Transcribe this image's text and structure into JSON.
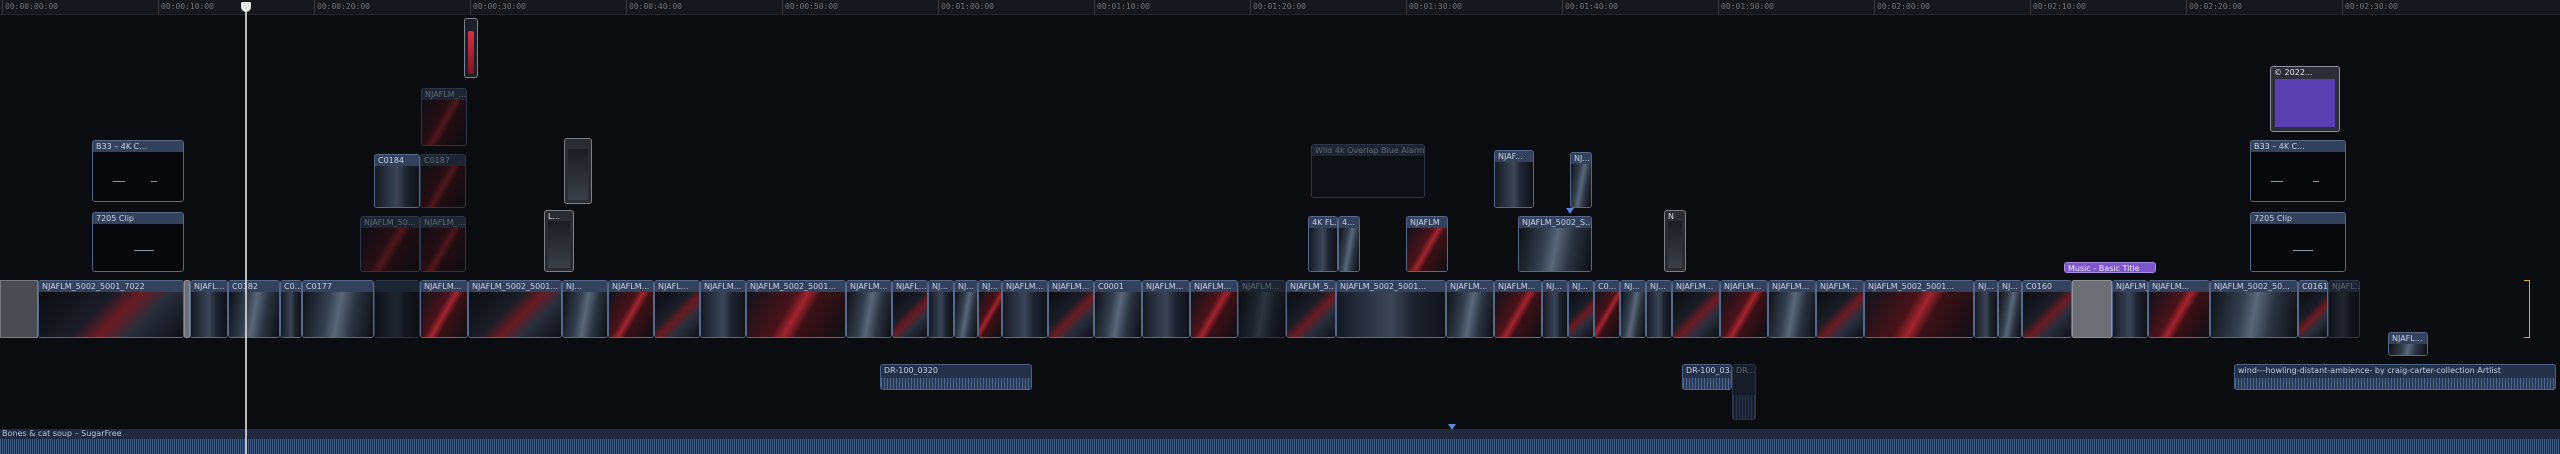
{
  "window_title": "",
  "ruler": {
    "labels": [
      "00:00:00:00",
      "00:00:10:00",
      "00:00:20:00",
      "00:00:30:00",
      "00:00:40:00",
      "00:00:50:00",
      "00:01:00:00",
      "00:01:10:00",
      "00:01:20:00",
      "00:01:30:00",
      "00:01:40:00",
      "00:01:50:00",
      "00:02:00:00",
      "00:02:10:00",
      "00:02:20:00",
      "00:02:30:00"
    ]
  },
  "connected_clips": {
    "nj_top_1": "NJAFLM_...",
    "c0184": "C0184",
    "c0187": "C0187",
    "nj_mid_1": "NJAFLM_50...",
    "nj_mid_2": "NJAFLM_...",
    "gray_l": "L...",
    "b33_left": "B33 – 4K C...",
    "clip_7205_left": "7205 Clip",
    "text_label_middle": "Wild 4k Overlap Blue Alarm (2)",
    "nj_f": "NJAF...",
    "nj_j": "NJ...",
    "nj_fl": "4K FL...",
    "nj_4": "4...",
    "nj_mid_3": "NJAFLM",
    "nj_mid_4": "NJAFLM_5002_S...",
    "nj_n": "N",
    "b33_right": "B33 – 4K C...",
    "clip_7205_right": "7205 Clip",
    "title_2022": "© 2022...",
    "nj_below": "NJAFL..."
  },
  "primary_storyline": [
    "NJAFLM_5002_5001_7022",
    "NJAFL...",
    "C0182",
    "C0...",
    "C0177",
    "",
    "NJAFLM...",
    "NJAFLM_5002_5001...",
    "NJ...",
    "NJAFLM...",
    "NJAFL...",
    "NJAFLM...",
    "NJAFLM_5002_5001...",
    "NJAFLM...",
    "NJAFL...",
    "NJ...",
    "NJ...",
    "NJ...",
    "NJAFLM...",
    "NJAFLM...",
    "C0001",
    "NJAFLM...",
    "NJAFLM...",
    "NJAFLM...",
    "NJAFLM_5...",
    "NJAFLM_5002_5001...",
    "NJAFLM...",
    "NJAFLM...",
    "NJ...",
    "NJ...",
    "C0...",
    "NJ...",
    "NJ...",
    "NJAFLM...",
    "NJAFLM...",
    "NJAFLM...",
    "NJAFLM...",
    "NJAFLM_5002_5001...",
    "NJ...",
    "NJ...",
    "C0160",
    "NJAFLM_5...",
    "NJAFLM...",
    "NJAFLM_5002_50...",
    "C0161",
    "NJAFL..."
  ],
  "title_clip_music": "Music - Basic Title",
  "audio_clips": {
    "dr1": "DR-100_0320",
    "dr2": "DR-100_03...",
    "dr3": "DR...",
    "wind": "wind---howling-distant-ambience- by craig-carter-collection Artlist"
  },
  "music_track": {
    "label": "Bones & cat soup – SugarFree"
  },
  "colors": {
    "clip_header": "#33415c",
    "audio": "#243149",
    "title_purple": "#7d57c9",
    "playhead": "#d8d8d8",
    "selection_gold": "#e0a83a"
  }
}
